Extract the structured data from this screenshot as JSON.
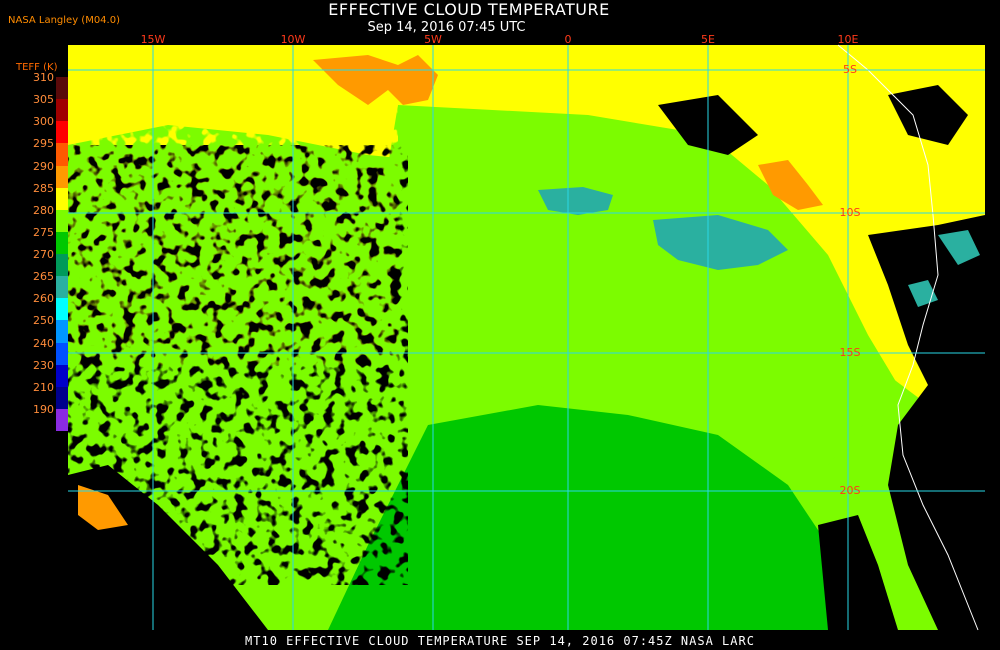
{
  "header": {
    "title": "EFFECTIVE CLOUD TEMPERATURE",
    "subtitle": "Sep 14, 2016 07:45 UTC",
    "credit": "NASA Langley (M04.0)"
  },
  "legend": {
    "title": "TEFF (K)",
    "labels": [
      "310",
      "305",
      "300",
      "295",
      "290",
      "285",
      "280",
      "275",
      "270",
      "265",
      "260",
      "250",
      "240",
      "230",
      "210",
      "190"
    ],
    "colors": [
      "#5a0a0a",
      "#a00000",
      "#ff0000",
      "#ff5a00",
      "#ff9a00",
      "#ffff00",
      "#7cfc00",
      "#00c800",
      "#009a5a",
      "#2ab0a0",
      "#00ffff",
      "#0096ff",
      "#0050ff",
      "#0000c8",
      "#00008c",
      "#8a2be2"
    ]
  },
  "map": {
    "longitude_labels": [
      "15W",
      "10W",
      "5W",
      "0",
      "5E",
      "10E"
    ],
    "latitude_labels": [
      "5S",
      "10S",
      "15S",
      "20S"
    ],
    "colors": {
      "grid": "#29d9e6",
      "label": "#ff3a1a",
      "coast": "#ffffff",
      "no_data": "#000000",
      "green_light": "#7cfc00",
      "green_dark": "#00c800",
      "yellow": "#ffff00",
      "orange": "#ff9a00",
      "teal": "#2ab0a0"
    }
  },
  "footer": {
    "text": "MT10  EFFECTIVE CLOUD TEMPERATURE  SEP 14, 2016 07:45Z  NASA LARC"
  }
}
